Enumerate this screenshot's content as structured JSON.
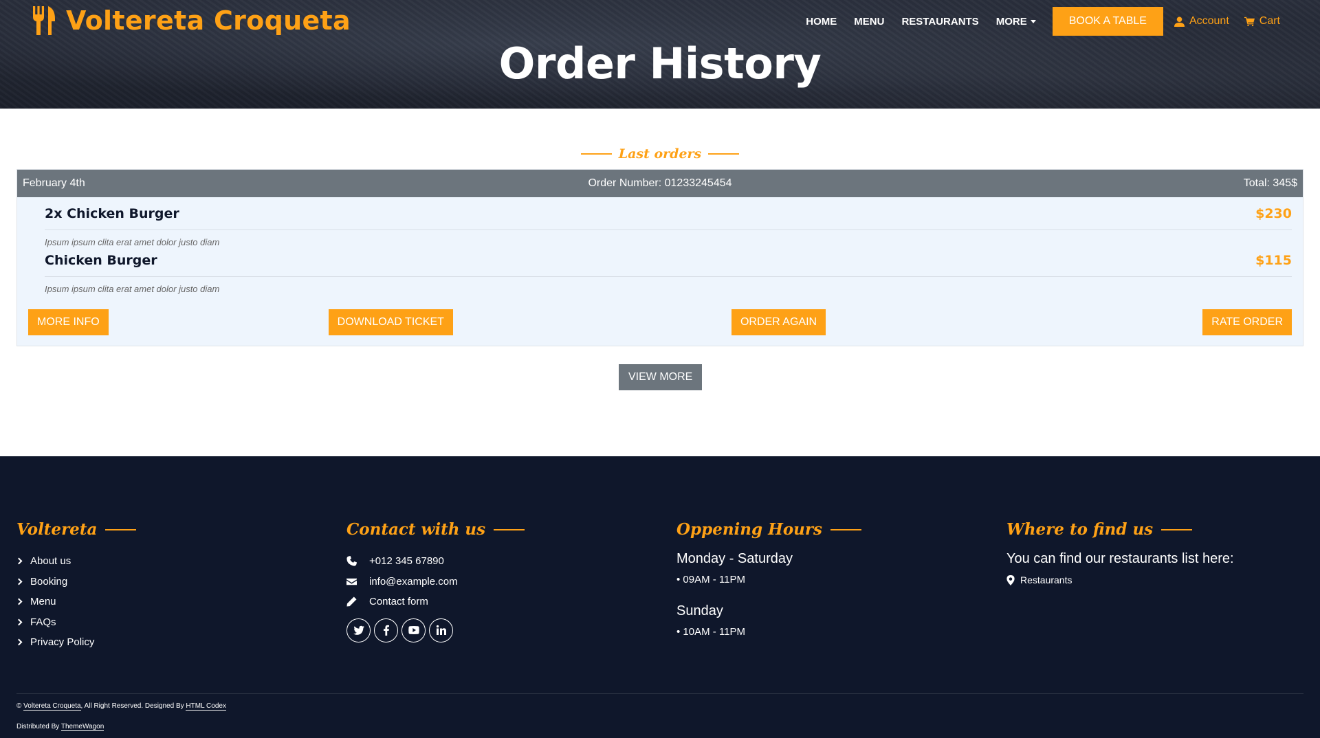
{
  "brand": {
    "name": "Voltereta Croqueta",
    "icon": "utensils-icon",
    "accent_color": "#FEA116"
  },
  "nav": {
    "home": "HOME",
    "menu": "MENU",
    "restaurants": "RESTAURANTS",
    "more": "MORE",
    "book_table": "BOOK A TABLE",
    "account": "Account",
    "cart": "Cart"
  },
  "hero": {
    "title": "Order History"
  },
  "section": {
    "subtitle": "Last orders"
  },
  "order": {
    "date": "February 4th",
    "number": "Order Number: 01233245454",
    "total": "Total: 345$",
    "items": [
      {
        "name": "2x Chicken Burger",
        "price": "$230",
        "description": "Ipsum ipsum clita erat amet dolor justo diam"
      },
      {
        "name": "Chicken Burger",
        "price": "$115",
        "description": "Ipsum ipsum clita erat amet dolor justo diam"
      }
    ],
    "actions": {
      "more_info": "MORE INFO",
      "download_ticket": "DOWNLOAD TICKET",
      "order_again": "ORDER AGAIN",
      "rate_order": "RATE ORDER"
    }
  },
  "view_more": "VIEW MORE",
  "footer": {
    "background_color": "#0f172b",
    "col1": {
      "title": "Voltereta",
      "links": [
        "About us",
        "Booking",
        "Menu",
        "FAQs",
        "Privacy Policy"
      ]
    },
    "col2": {
      "title": "Contact with us",
      "phone": "+012 345 67890",
      "email": "info@example.com",
      "form": "Contact form",
      "socials": [
        "twitter-icon",
        "facebook-icon",
        "youtube-icon",
        "linkedin-icon"
      ]
    },
    "col3": {
      "title": "Oppening Hours",
      "day1": "Monday - Saturday",
      "time1": "• 09AM - 11PM",
      "day2": "Sunday",
      "time2": "• 10AM - 11PM"
    },
    "col4": {
      "title": "Where to find us",
      "text": "You can find our restaurants list here:",
      "link": "Restaurants"
    },
    "copyright": {
      "prefix": "©",
      "brand": "Voltereta Croqueta",
      "middle": ", All Right Reserved. Designed By",
      "designer": "HTML Codex",
      "dist_prefix": "Distributed By",
      "distributor": "ThemeWagon"
    }
  }
}
